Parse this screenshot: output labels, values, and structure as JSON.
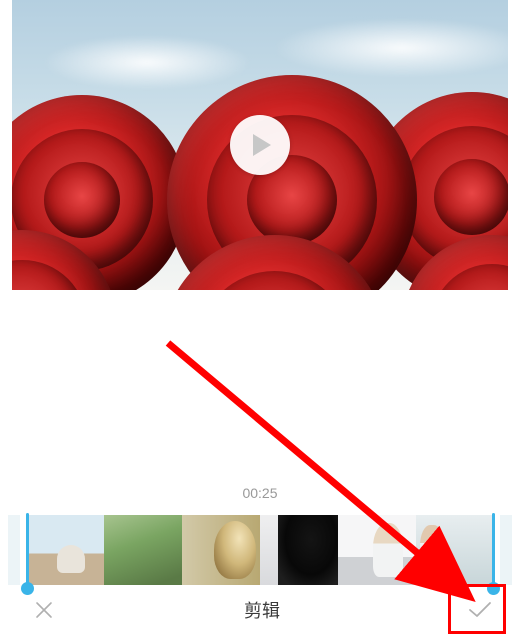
{
  "preview": {
    "play_icon": "play-icon"
  },
  "timeline": {
    "time_display": "00:25"
  },
  "bottom_bar": {
    "cancel_icon": "close-icon",
    "title": "剪辑",
    "confirm_icon": "check-icon"
  },
  "annotation": {
    "arrow_color": "#ff0000",
    "highlight_color": "#ff0000"
  },
  "colors": {
    "accent": "#3ab4e8",
    "muted_text": "#999999"
  }
}
